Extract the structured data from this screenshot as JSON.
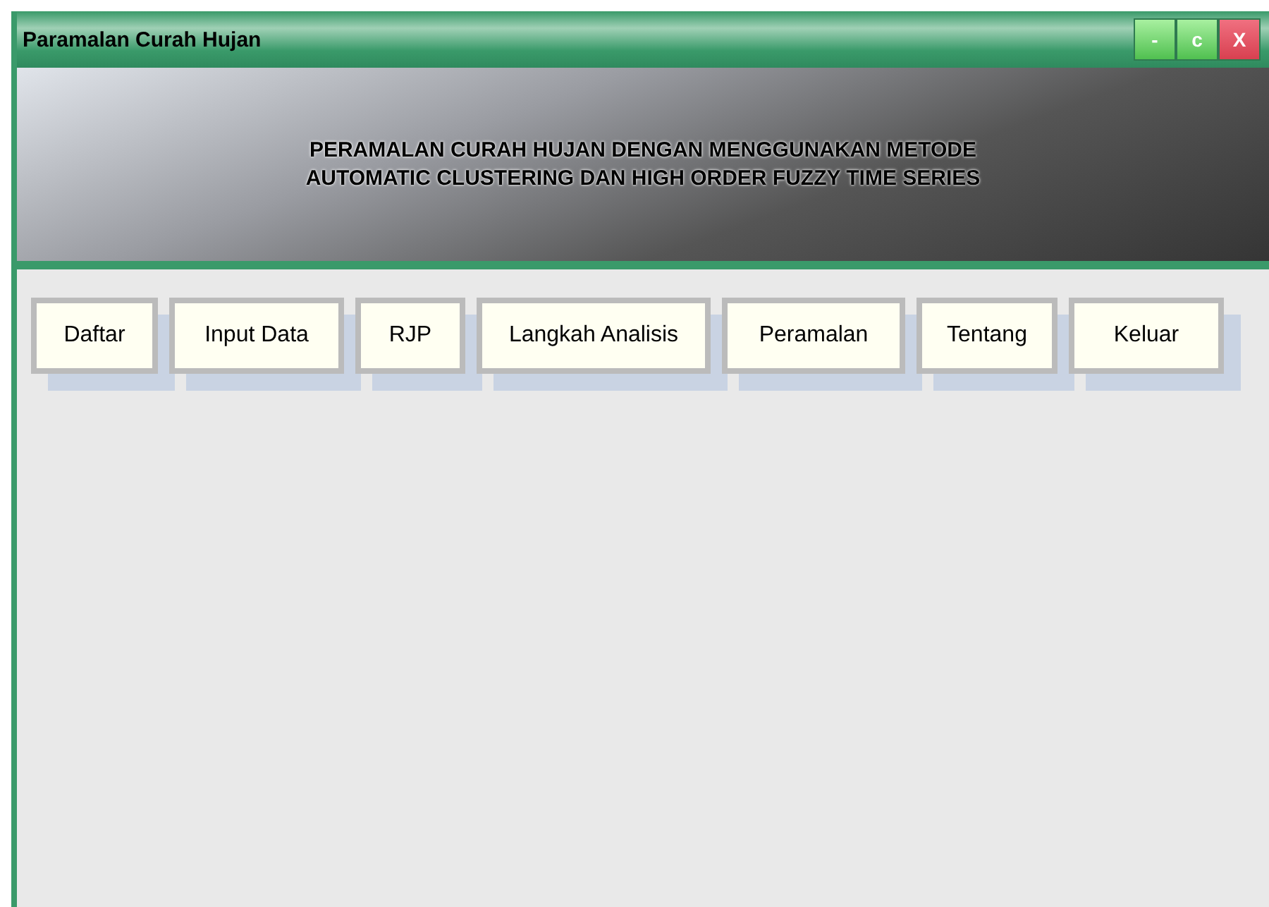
{
  "window": {
    "title": "Paramalan Curah Hujan",
    "controls": [
      {
        "kind": "minimize",
        "label": "-"
      },
      {
        "kind": "restore",
        "label": "c"
      },
      {
        "kind": "close",
        "label": "X"
      }
    ]
  },
  "banner": {
    "lines": [
      "PERAMALAN CURAH HUJAN DENGAN MENGGUNAKAN METODE",
      "AUTOMATIC CLUSTERING DAN HIGH ORDER FUZZY TIME SERIES"
    ]
  },
  "menu": [
    "Daftar",
    "Input Data",
    "RJP",
    "Langkah Analisis",
    "Peramalan",
    "Tentang",
    "Keluar"
  ]
}
